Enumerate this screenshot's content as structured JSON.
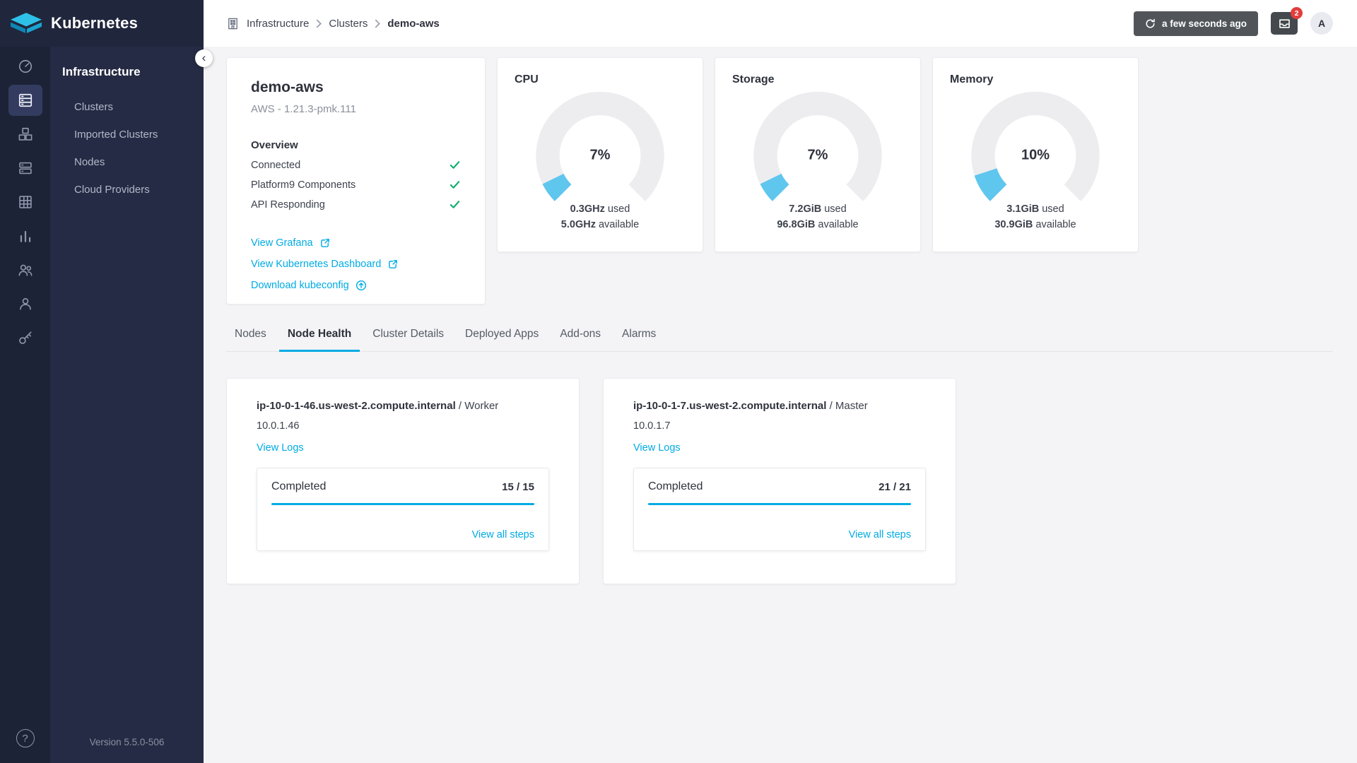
{
  "app": {
    "title": "Kubernetes"
  },
  "sidebar": {
    "section_title": "Infrastructure",
    "items": [
      {
        "label": "Clusters"
      },
      {
        "label": "Imported Clusters"
      },
      {
        "label": "Nodes"
      },
      {
        "label": "Cloud Providers"
      }
    ],
    "version": "Version 5.5.0-506",
    "help_glyph": "?"
  },
  "header": {
    "breadcrumb": {
      "root": "Infrastructure",
      "section": "Clusters",
      "current": "demo-aws"
    },
    "refresh_label": "a few seconds ago",
    "notification_count": "2",
    "avatar_initial": "A"
  },
  "cluster": {
    "name": "demo-aws",
    "subtitle": "AWS - 1.21.3-pmk.111",
    "overview_title": "Overview",
    "checks": [
      {
        "label": "Connected"
      },
      {
        "label": "Platform9 Components"
      },
      {
        "label": "API Responding"
      }
    ],
    "links": [
      {
        "label": "View Grafana"
      },
      {
        "label": "View Kubernetes Dashboard"
      },
      {
        "label": "Download kubeconfig"
      }
    ]
  },
  "gauges": [
    {
      "title": "CPU",
      "percent": 7,
      "percent_label": "7%",
      "used_value": "0.3GHz",
      "used_label": " used",
      "available_value": "5.0GHz",
      "available_label": " available"
    },
    {
      "title": "Storage",
      "percent": 7,
      "percent_label": "7%",
      "used_value": "7.2GiB",
      "used_label": " used",
      "available_value": "96.8GiB",
      "available_label": " available"
    },
    {
      "title": "Memory",
      "percent": 10,
      "percent_label": "10%",
      "used_value": "3.1GiB",
      "used_label": " used",
      "available_value": "30.9GiB",
      "available_label": " available"
    }
  ],
  "tabs": [
    {
      "label": "Nodes"
    },
    {
      "label": "Node Health"
    },
    {
      "label": "Cluster Details"
    },
    {
      "label": "Deployed Apps"
    },
    {
      "label": "Add-ons"
    },
    {
      "label": "Alarms"
    }
  ],
  "nodes": [
    {
      "hostname": "ip-10-0-1-46.us-west-2.compute.internal",
      "role": " / Worker",
      "ip": "10.0.1.46",
      "logs_label": "View Logs",
      "step_label": "Completed",
      "step_count": "15 / 15",
      "progress": 100,
      "all_steps_label": "View all steps"
    },
    {
      "hostname": "ip-10-0-1-7.us-west-2.compute.internal",
      "role": " / Master",
      "ip": "10.0.1.7",
      "logs_label": "View Logs",
      "step_label": "Completed",
      "step_count": "21 / 21",
      "progress": 100,
      "all_steps_label": "View all steps"
    }
  ],
  "colors": {
    "accent": "#00abe4",
    "gauge_fill": "#5fc6ee",
    "success": "#0fae6d",
    "sidebar": "#252b44"
  }
}
